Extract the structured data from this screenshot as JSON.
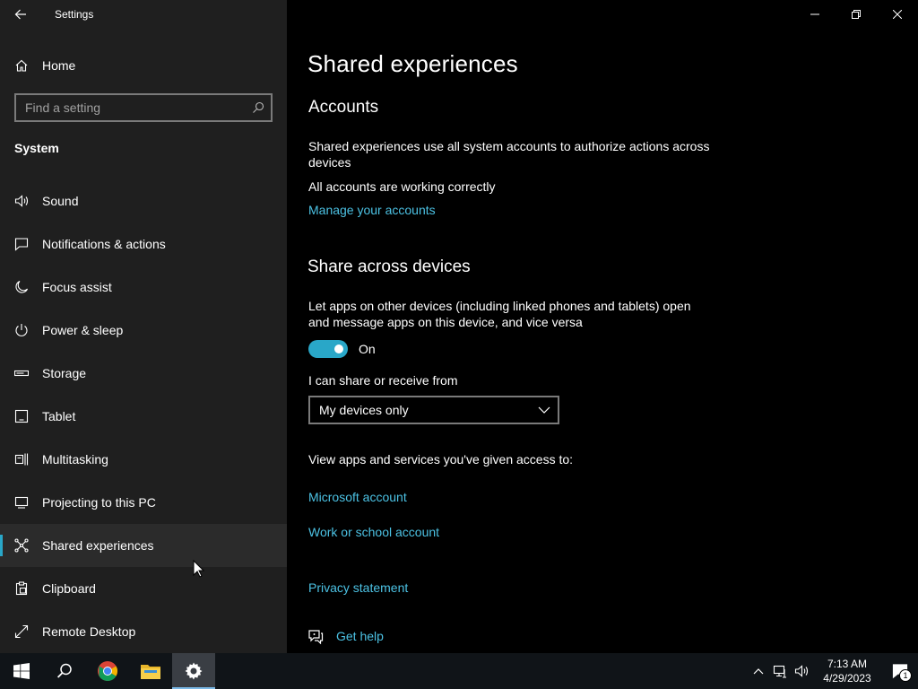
{
  "window": {
    "title": "Settings"
  },
  "sidebar": {
    "home_label": "Home",
    "search_placeholder": "Find a setting",
    "section_title": "System",
    "items": [
      {
        "label": "Sound",
        "icon": "speaker-icon"
      },
      {
        "label": "Notifications & actions",
        "icon": "notification-icon"
      },
      {
        "label": "Focus assist",
        "icon": "moon-icon"
      },
      {
        "label": "Power & sleep",
        "icon": "power-icon"
      },
      {
        "label": "Storage",
        "icon": "storage-icon"
      },
      {
        "label": "Tablet",
        "icon": "tablet-icon"
      },
      {
        "label": "Multitasking",
        "icon": "multitasking-icon"
      },
      {
        "label": "Projecting to this PC",
        "icon": "projecting-icon"
      },
      {
        "label": "Shared experiences",
        "icon": "shared-experiences-icon",
        "active": true
      },
      {
        "label": "Clipboard",
        "icon": "clipboard-icon"
      },
      {
        "label": "Remote Desktop",
        "icon": "remote-desktop-icon"
      }
    ]
  },
  "main": {
    "page_title": "Shared experiences",
    "accounts": {
      "heading": "Accounts",
      "description": "Shared experiences use all system accounts to authorize actions across devices",
      "status": "All accounts are working correctly",
      "manage_link": "Manage your accounts"
    },
    "share": {
      "heading": "Share across devices",
      "description": "Let apps on other devices (including linked phones and tablets) open and message apps on this device, and vice versa",
      "toggle_state": "On",
      "toggle_on": true,
      "receive_label": "I can share or receive from",
      "receive_value": "My devices only",
      "view_apps_label": "View apps and services you've given access to:",
      "microsoft_account_link": "Microsoft account",
      "work_school_link": "Work or school account"
    },
    "privacy_link": "Privacy statement",
    "help_link": "Get help"
  },
  "taskbar": {
    "time": "7:13 AM",
    "date": "4/29/2023",
    "notification_count": "1"
  },
  "colors": {
    "accent": "#29a7c8",
    "link": "#4cc2e4",
    "sidebar_bg": "#1f1f1f",
    "main_bg": "#000000",
    "taskbar_bg": "#101418"
  }
}
